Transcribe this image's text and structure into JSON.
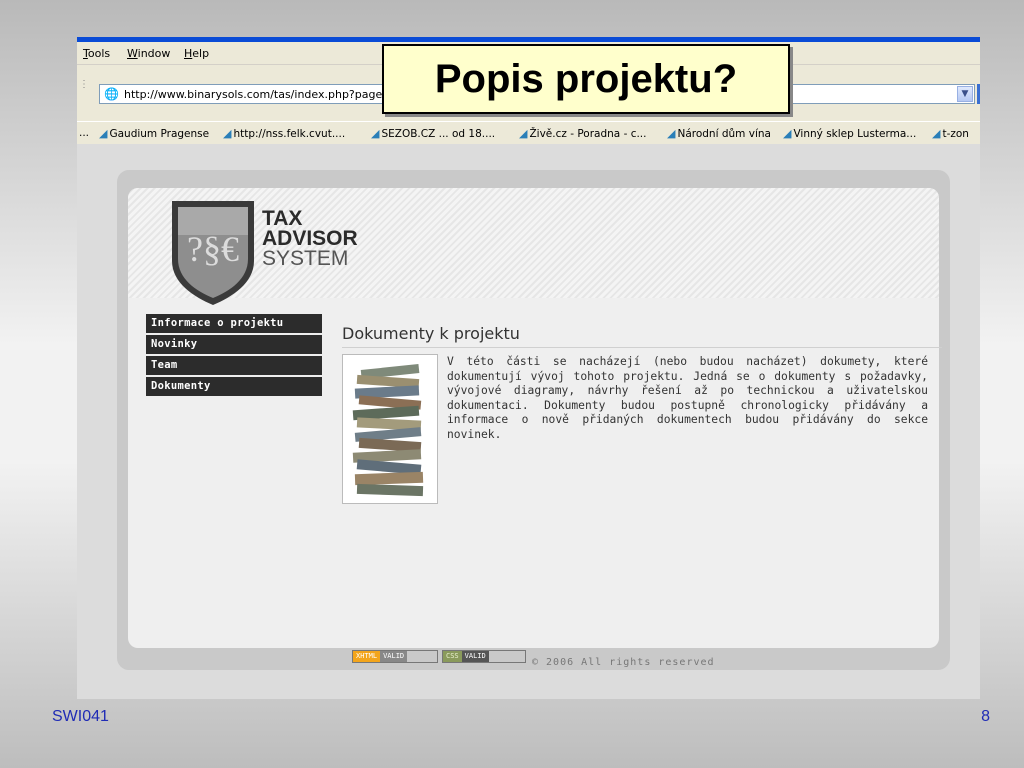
{
  "slide": {
    "title": "Popis projektu?",
    "footer_left": "SWI041",
    "footer_right": "8"
  },
  "browser": {
    "menu": [
      "Tools",
      "Window",
      "Help"
    ],
    "address": "http://www.binarysols.com/tas/index.php?page_i",
    "favorites_lead": "...",
    "favorites": [
      "Gaudium Pragense",
      "http://nss.felk.cvut....",
      "SEZOB.CZ ... od 18....",
      "Živě.cz - Poradna - c...",
      "Národní dům vína",
      "Vinný sklep Lusterma...",
      "t-zon"
    ]
  },
  "site": {
    "logo": {
      "line1": "TAX",
      "line2": "ADVISOR",
      "line3": "SYSTEM",
      "seal_text": "?§€"
    },
    "nav": [
      "Informace o projektu",
      "Novinky",
      "Team",
      "Dokumenty"
    ],
    "content_title": "Dokumenty k projektu",
    "content_text": "V této části se nacházejí (nebo budou nacházet) dokumety, které dokumentují vývoj tohoto projektu. Jedná se o dokumenty s požadavky, vývojové diagramy, návrhy řešení až po technickou a uživatelskou dokumentaci. Dokumenty budou postupně chronologicky přidávány a informace o nově přidaných dokumentech budou přidávány do sekce novinek.",
    "badge_xhtml": {
      "key": "XHTML",
      "value": "VALID"
    },
    "badge_css": {
      "key": "CSS",
      "value": "VALID"
    },
    "copyright": "© 2006 All rights reserved"
  },
  "colors": {
    "slide_title_bg": "#ffffcc",
    "footer_text": "#1f2bb5",
    "nav_bg": "#2c2c2c",
    "xp_blue": "#0a4bd6"
  }
}
